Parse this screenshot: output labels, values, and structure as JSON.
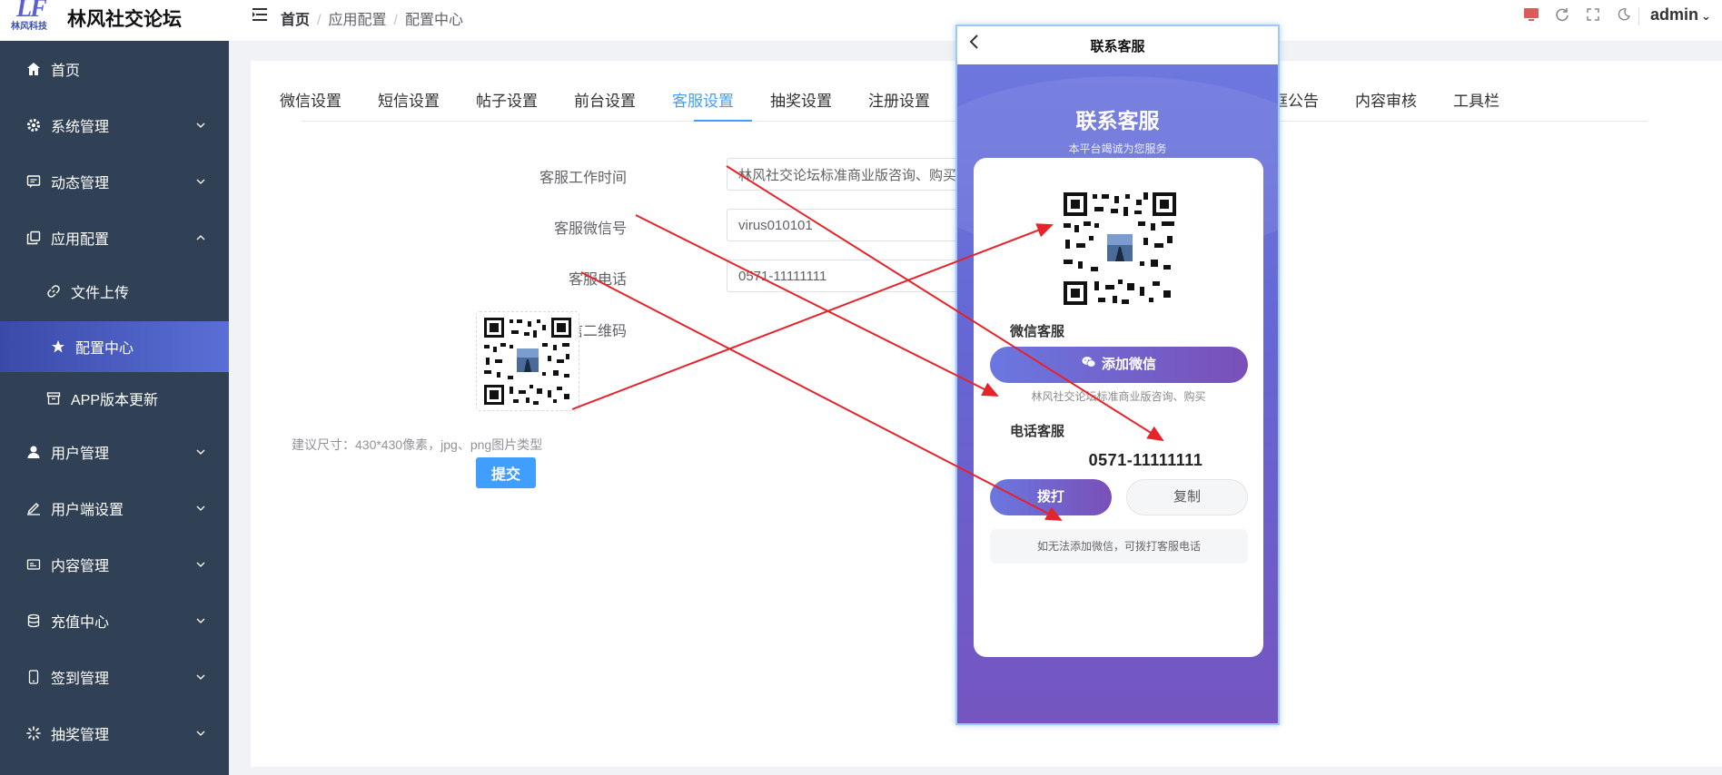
{
  "app": {
    "logo_text": "LF",
    "logo_subtext": "林风科技",
    "title": "林风社交论坛"
  },
  "breadcrumb": [
    "首页",
    "应用配置",
    "配置中心"
  ],
  "header": {
    "user": "admin"
  },
  "sidebar": {
    "items": [
      {
        "label": "首页"
      },
      {
        "label": "系统管理"
      },
      {
        "label": "动态管理"
      },
      {
        "label": "应用配置"
      },
      {
        "label": "文件上传"
      },
      {
        "label": "配置中心"
      },
      {
        "label": "APP版本更新"
      },
      {
        "label": "用户管理"
      },
      {
        "label": "用户端设置"
      },
      {
        "label": "内容管理"
      },
      {
        "label": "充值中心"
      },
      {
        "label": "签到管理"
      },
      {
        "label": "抽奖管理"
      }
    ]
  },
  "tabs": [
    "微信设置",
    "短信设置",
    "帖子设置",
    "前台设置",
    "客服设置",
    "抽奖设置",
    "注册设置",
    "弹框公告",
    "内容审核",
    "工具栏"
  ],
  "active_tab": "客服设置",
  "form": {
    "hours_label": "客服工作时间",
    "hours_value": "林风社交论坛标准商业版咨询、购买",
    "wechat_label": "客服微信号",
    "wechat_value": "virus010101",
    "phone_label": "客服电话",
    "phone_value": "0571-11111111",
    "qr_label": "客服微信二维码",
    "hint": "建议尺寸：430*430像素，jpg、png图片类型",
    "submit": "提交"
  },
  "preview": {
    "nav_title": "联系客服",
    "hero_title": "联系客服",
    "hero_sub": "本平台竭诚为您服务",
    "wechat_section": "微信客服",
    "wechat_button": "添加微信",
    "wechat_desc": "林风社交论坛标准商业版咨询、购买",
    "phone_section": "电话客服",
    "phone_number": "0571-11111111",
    "call_button": "拨打",
    "copy_button": "复制",
    "tip": "如无法添加微信，可拨打客服电话"
  },
  "colors": {
    "sidebar_bg": "#304156",
    "accent": "#409eff",
    "active_menu": "#4a5cc4",
    "annotation_arrow": "#e5232a"
  }
}
